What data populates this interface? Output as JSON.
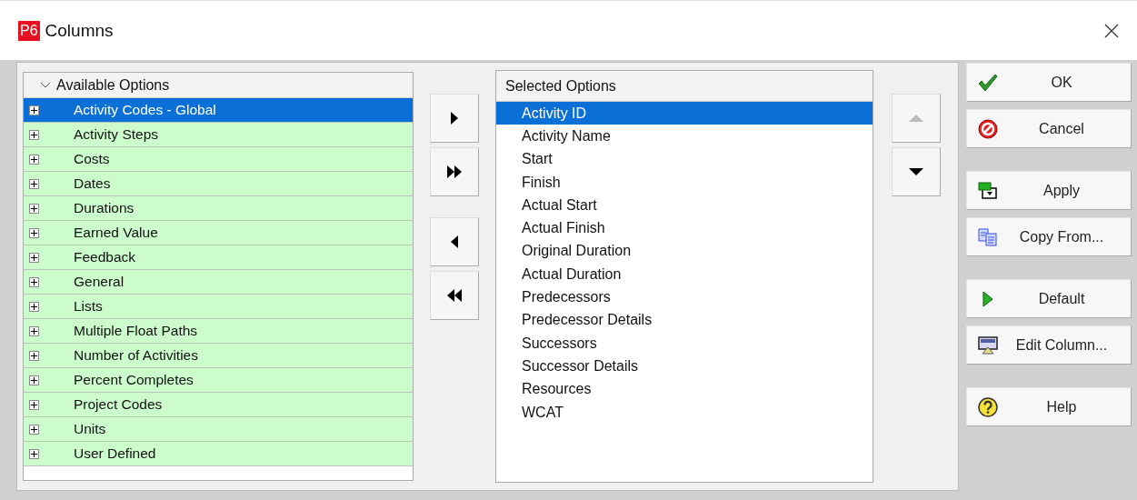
{
  "window": {
    "logo": "P6",
    "title": "Columns"
  },
  "available": {
    "header": "Available Options",
    "items": [
      {
        "label": "Activity Codes - Global",
        "selected": true,
        "expanded": false
      },
      {
        "label": "Activity Steps",
        "selected": false,
        "expanded": false
      },
      {
        "label": "Costs",
        "selected": false,
        "expanded": false
      },
      {
        "label": "Dates",
        "selected": false,
        "expanded": false
      },
      {
        "label": "Durations",
        "selected": false,
        "expanded": false
      },
      {
        "label": "Earned Value",
        "selected": false,
        "expanded": false
      },
      {
        "label": "Feedback",
        "selected": false,
        "expanded": false
      },
      {
        "label": "General",
        "selected": false,
        "expanded": false
      },
      {
        "label": "Lists",
        "selected": false,
        "expanded": false
      },
      {
        "label": "Multiple Float Paths",
        "selected": false,
        "expanded": false
      },
      {
        "label": "Number of Activities",
        "selected": false,
        "expanded": false
      },
      {
        "label": "Percent Completes",
        "selected": false,
        "expanded": false
      },
      {
        "label": "Project Codes",
        "selected": false,
        "expanded": false
      },
      {
        "label": "Units",
        "selected": false,
        "expanded": false
      },
      {
        "label": "User Defined",
        "selected": false,
        "expanded": false
      }
    ]
  },
  "move_buttons": [
    {
      "kind": "add",
      "disabled": false
    },
    {
      "kind": "add_all",
      "disabled": false
    },
    {
      "kind": "remove",
      "disabled": false
    },
    {
      "kind": "remove_all",
      "disabled": false
    }
  ],
  "selected_list": {
    "header": "Selected Options",
    "items": [
      {
        "label": "Activity ID",
        "selected": true
      },
      {
        "label": "Activity Name",
        "selected": false
      },
      {
        "label": "Start",
        "selected": false
      },
      {
        "label": "Finish",
        "selected": false
      },
      {
        "label": "Actual Start",
        "selected": false
      },
      {
        "label": "Actual Finish",
        "selected": false
      },
      {
        "label": "Original Duration",
        "selected": false
      },
      {
        "label": "Actual Duration",
        "selected": false
      },
      {
        "label": "Predecessors",
        "selected": false
      },
      {
        "label": "Predecessor Details",
        "selected": false
      },
      {
        "label": "Successors",
        "selected": false
      },
      {
        "label": "Successor Details",
        "selected": false
      },
      {
        "label": "Resources",
        "selected": false
      },
      {
        "label": "WCAT",
        "selected": false
      }
    ]
  },
  "order_buttons": [
    {
      "kind": "up",
      "disabled": true
    },
    {
      "kind": "down",
      "disabled": false
    }
  ],
  "buttons": [
    {
      "kind": "ok",
      "label": "OK"
    },
    {
      "kind": "cancel",
      "label": "Cancel"
    },
    {
      "kind": "apply",
      "label": "Apply"
    },
    {
      "kind": "copy",
      "label": "Copy From..."
    },
    {
      "kind": "default",
      "label": "Default"
    },
    {
      "kind": "edit",
      "label": "Edit Column..."
    },
    {
      "kind": "help",
      "label": "Help"
    }
  ]
}
